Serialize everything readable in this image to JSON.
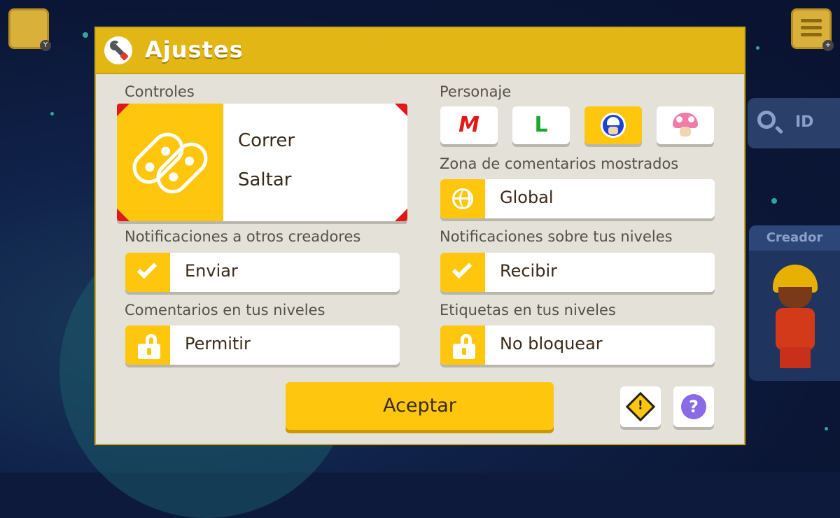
{
  "background": {
    "search_label": "ID",
    "creator_label": "Creador"
  },
  "dialog": {
    "title": "Ajustes",
    "title_icon": "wrench-icon"
  },
  "controls": {
    "label": "Controles",
    "icon": "joycon-icon",
    "line1": "Correr",
    "line2": "Saltar"
  },
  "character": {
    "label": "Personaje",
    "options": [
      {
        "name": "mario",
        "glyph": "M",
        "selected": false
      },
      {
        "name": "luigi",
        "glyph": "L",
        "selected": false
      },
      {
        "name": "toad",
        "glyph": "",
        "selected": true
      },
      {
        "name": "toadette",
        "glyph": "",
        "selected": false
      }
    ]
  },
  "comment_zone": {
    "label": "Zona de comentarios mostrados",
    "icon": "globe-icon",
    "value": "Global"
  },
  "notify_others": {
    "label": "Notificaciones a otros creadores",
    "icon": "check-icon",
    "value": "Enviar"
  },
  "notify_levels": {
    "label": "Notificaciones sobre tus niveles",
    "icon": "check-icon",
    "value": "Recibir"
  },
  "comments_levels": {
    "label": "Comentarios en tus niveles",
    "icon": "lock-open-icon",
    "value": "Permitir"
  },
  "tags_levels": {
    "label": "Etiquetas en tus niveles",
    "icon": "lock-open-icon",
    "value": "No bloquear"
  },
  "footer": {
    "accept_label": "Aceptar",
    "warning_glyph": "!",
    "help_glyph": "?"
  },
  "colors": {
    "accent": "#fec60d",
    "header": "#e2b615",
    "panel": "#e4e1d8",
    "corner_red": "#e01818"
  }
}
